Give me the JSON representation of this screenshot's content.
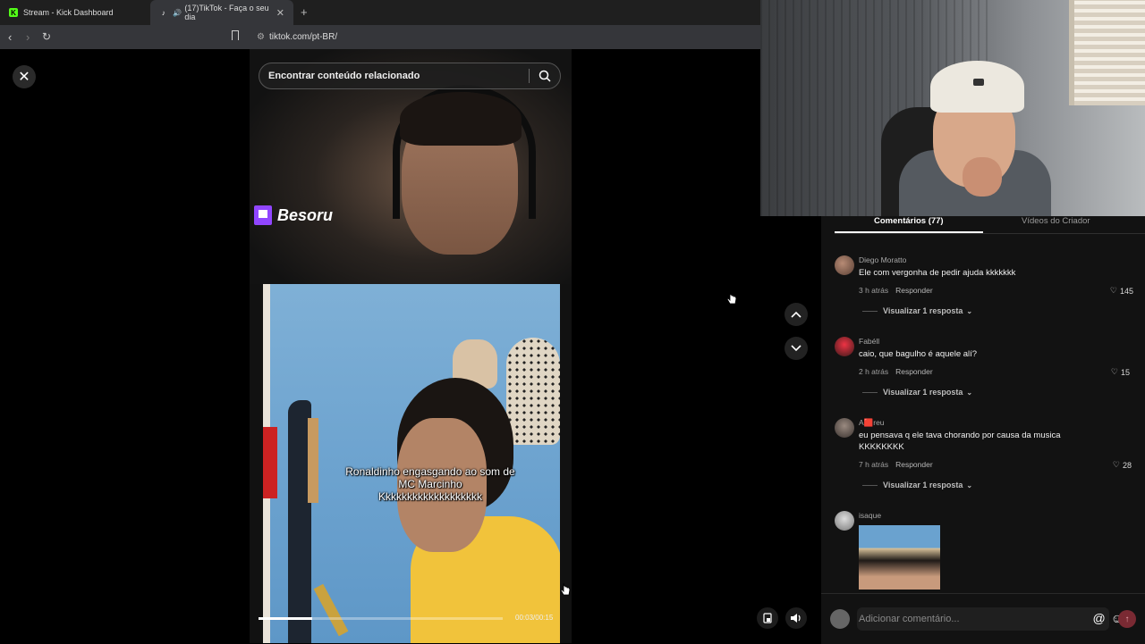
{
  "browser": {
    "tabs": [
      {
        "title": "Stream - Kick Dashboard",
        "favicon": "kick-logo",
        "color": "#53fc18",
        "active": false
      },
      {
        "title": "(17)TikTok - Faça o seu dia",
        "favicon": "tiktok-logo",
        "active": true
      }
    ],
    "url": "tiktok.com/pt-BR/"
  },
  "video": {
    "search_placeholder": "Encontrar conteúdo relacionado",
    "brand_label": "Besoru",
    "caption": "Ronaldinho engasgando ao som de MC Marcinho Kkkkkkkkkkkkkkkkkkk",
    "time": "00:03/00:15",
    "progress": 0.22
  },
  "panel": {
    "tabs": [
      {
        "label": "Comentários (77)",
        "active": true
      },
      {
        "label": "Vídeos do Criador",
        "active": false
      }
    ],
    "comments": [
      {
        "name": "Diego Moratto",
        "text": "Ele com vergonha de pedir ajuda kkkkkkk",
        "time": "3 h atrás",
        "reply": "Responder",
        "likes": "145",
        "view_replies": "Visualizar 1 resposta"
      },
      {
        "name": "Fabéll",
        "text": "caio, que bagulho é aquele alí?",
        "time": "2 h atrás",
        "reply": "Responder",
        "likes": "15",
        "view_replies": "Visualizar 1 resposta"
      },
      {
        "name": "A🟥reu",
        "text": "eu pensava q ele tava chorando por causa da musica KKKKKKKK",
        "time": "7 h atrás",
        "reply": "Responder",
        "likes": "28",
        "view_replies": "Visualizar 1 resposta"
      },
      {
        "name": "isaque"
      }
    ],
    "composer_placeholder": "Adicionar comentário..."
  },
  "colors": {
    "accent": "#fe2c55",
    "twitch": "#9146ff"
  }
}
